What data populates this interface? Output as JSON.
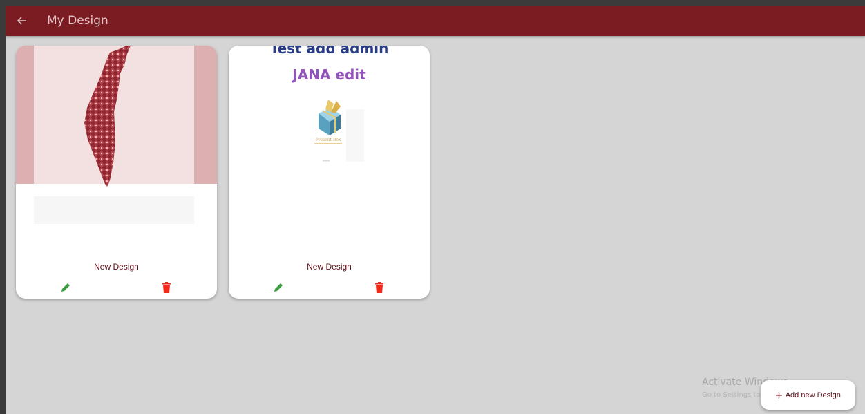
{
  "appbar": {
    "title": "My Design",
    "color": "#7b1c22"
  },
  "designs": [
    {
      "label": "New Design",
      "preview": "palestine-map-tatreez"
    },
    {
      "label": "New Design",
      "preview_texts": [
        "Test add admin",
        "JANA edit"
      ],
      "logo_caption": "Present Box"
    }
  ],
  "actions": {
    "edit_icon": "pencil-icon",
    "delete_icon": "trash-icon",
    "edit_color": "#3a9a3e",
    "delete_color": "#f0291b"
  },
  "fab": {
    "label": "Add new Design",
    "icon": "plus-icon"
  },
  "watermark": {
    "title": "Activate Windows",
    "subtitle": "Go to Settings to activate Windows."
  }
}
